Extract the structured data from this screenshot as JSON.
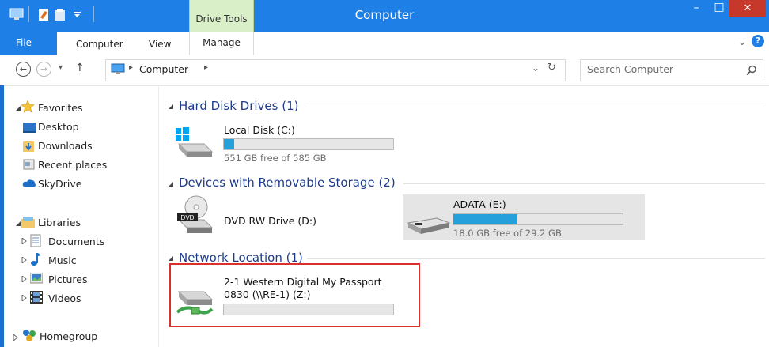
{
  "window": {
    "title": "Computer",
    "context_tab_group": "Drive Tools",
    "minimize_glyph": "–",
    "maximize_glyph": "□",
    "close_glyph": "✕"
  },
  "ribbon": {
    "tabs": [
      "File",
      "Computer",
      "View",
      "Manage"
    ],
    "expand_glyph": "⌄",
    "help_glyph": "?"
  },
  "address": {
    "crumb": "Computer",
    "sep1": "▸",
    "sep2": "▸",
    "back_glyph": "←",
    "forward_glyph": "→",
    "recent_glyph": "▾",
    "up_glyph": "↑",
    "dropdown_glyph": "⌄",
    "refresh_glyph": "↻",
    "search_placeholder": "Search Computer"
  },
  "nav": {
    "favorites": {
      "label": "Favorites",
      "items": [
        "Desktop",
        "Downloads",
        "Recent places",
        "SkyDrive"
      ]
    },
    "libraries": {
      "label": "Libraries",
      "items": [
        "Documents",
        "Music",
        "Pictures",
        "Videos"
      ]
    },
    "homegroup": "Homegroup"
  },
  "groups": {
    "hdd": {
      "header": "Hard Disk Drives (1)",
      "drives": [
        {
          "name": "Local Disk (C:)",
          "free": "551 GB free of 585 GB",
          "used_fraction": 0.06
        }
      ]
    },
    "removable": {
      "header": "Devices with Removable Storage (2)",
      "dvd": {
        "name": "DVD RW Drive (D:)",
        "label": "DVD"
      },
      "adata": {
        "name": "ADATA (E:)",
        "free": "18.0 GB free of 29.2 GB",
        "used_fraction": 0.38
      }
    },
    "network": {
      "header": "Network Location (1)",
      "drive": {
        "name_line1": "2-1 Western Digital My Passport",
        "name_line2": "0830 (\\\\RE-1) (Z:)",
        "used_fraction": 0
      }
    }
  },
  "colors": {
    "accent": "#1e80e6",
    "highlight": "#d9302c",
    "bar_fill": "#26a0da",
    "context_tab": "#d9efc8"
  }
}
